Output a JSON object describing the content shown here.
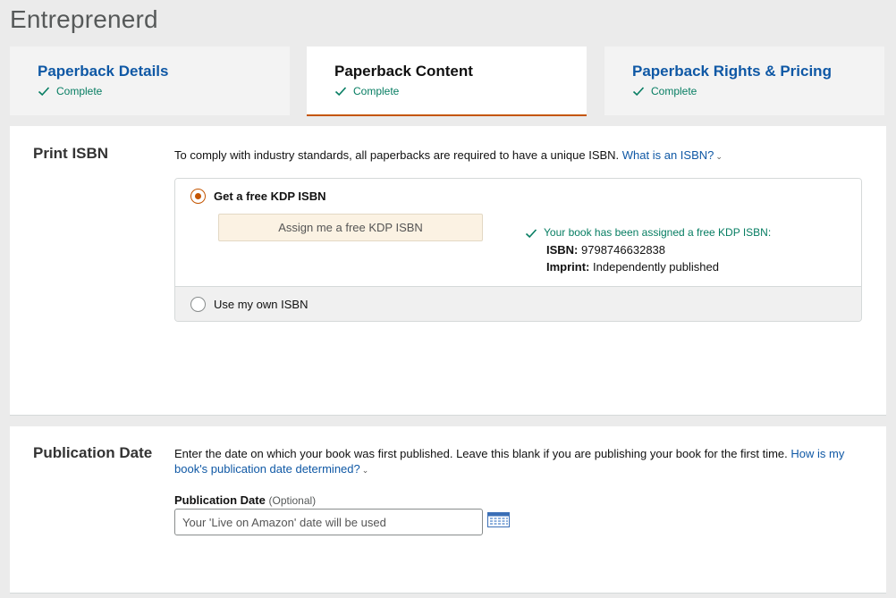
{
  "app": {
    "title": "Entreprenerd"
  },
  "tabs": [
    {
      "label": "Paperback Details",
      "status": "Complete",
      "active": false
    },
    {
      "label": "Paperback Content",
      "status": "Complete",
      "active": true
    },
    {
      "label": "Paperback Rights & Pricing",
      "status": "Complete",
      "active": false
    }
  ],
  "print_isbn": {
    "title": "Print ISBN",
    "description": "To comply with industry standards, all paperbacks are required to have a unique ISBN.",
    "link": "What is an ISBN?",
    "option_free": {
      "label": "Get a free KDP ISBN",
      "selected": true,
      "button_label": "Assign me a free KDP ISBN",
      "assigned_message": "Your book has been assigned a free KDP ISBN:",
      "isbn_key": "ISBN:",
      "isbn_value": "9798746632838",
      "imprint_key": "Imprint:",
      "imprint_value": "Independently published"
    },
    "option_own": {
      "label": "Use my own ISBN",
      "selected": false
    }
  },
  "publication_date": {
    "title": "Publication Date",
    "description": "Enter the date on which your book was first published. Leave this blank if you are publishing your book for the first time.",
    "link": "How is my book's publication date determined?",
    "field_label": "Publication Date",
    "field_optional": "(Optional)",
    "placeholder": "Your 'Live on Amazon' date will be used",
    "value": ""
  },
  "colors": {
    "link": "#0f58a5",
    "success": "#067d62",
    "accent": "#c45500",
    "button_bg": "#fbf2e3"
  },
  "icons": {
    "status": "check-icon",
    "calendar": "calendar-icon",
    "expand": "chevron-down-icon"
  }
}
